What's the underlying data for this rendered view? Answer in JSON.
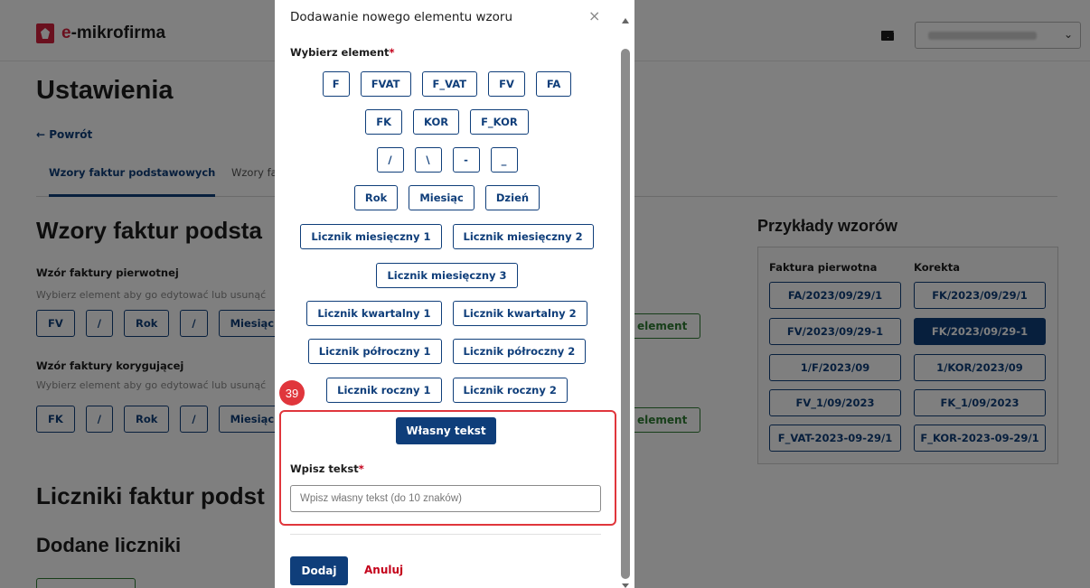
{
  "header": {
    "brand": "e-mikrofirma",
    "user_name": "",
    "mail_icon": "mail-icon",
    "chevron_icon": "chevron-down-icon"
  },
  "page": {
    "title": "Ustawienia",
    "back": "← Powrót",
    "tabs": [
      "Wzory faktur podstawowych",
      "Wzory fa"
    ],
    "section_title": "Wzory faktur podsta",
    "primary_label": "Wzór faktury pierwotnej",
    "primary_hint": "Wybierz element aby go edytować lub usunąć",
    "primary_chips": [
      "FV",
      "/",
      "Rok",
      "/",
      "Miesiąc"
    ],
    "correction_label": "Wzór faktury korygującej",
    "correction_hint": "Wybierz element aby go edytować lub usunąć",
    "correction_chips": [
      "FK",
      "/",
      "Rok",
      "/",
      "Miesiąc"
    ],
    "add_element": "element",
    "counters_title": "Liczniki faktur podst",
    "added_counters_title": "Dodane liczniki"
  },
  "examples": {
    "title": "Przykłady wzorów",
    "col_primary": "Faktura pierwotna",
    "col_correction": "Korekta",
    "rows": [
      [
        "FA/2023/09/29/1",
        "FK/2023/09/29/1"
      ],
      [
        "FV/2023/09/29-1",
        "FK/2023/09/29-1"
      ],
      [
        "1/F/2023/09",
        "1/KOR/2023/09"
      ],
      [
        "FV_1/09/2023",
        "FK_1/09/2023"
      ],
      [
        "F_VAT-2023-09-29/1",
        "F_KOR-2023-09-29/1"
      ]
    ],
    "selected": "FK/2023/09/29-1"
  },
  "modal": {
    "title": "Dodawanie nowego elementu wzoru",
    "close": "×",
    "choose_label": "Wybierz element",
    "required_mark": "*",
    "row1": [
      "F",
      "FVAT",
      "F_VAT",
      "FV",
      "FA"
    ],
    "row2": [
      "FK",
      "KOR",
      "F_KOR"
    ],
    "row3": [
      "/",
      "\\",
      "-",
      "_"
    ],
    "row4": [
      "Rok",
      "Miesiąc",
      "Dzień"
    ],
    "row5": [
      "Licznik miesięczny 1",
      "Licznik miesięczny 2"
    ],
    "row6": [
      "Licznik miesięczny 3"
    ],
    "row7": [
      "Licznik kwartalny 1",
      "Licznik kwartalny 2"
    ],
    "row8": [
      "Licznik półroczny 1",
      "Licznik półroczny 2"
    ],
    "row9": [
      "Licznik roczny 1",
      "Licznik roczny 2"
    ],
    "badge": "39",
    "own_text_button": "Własny tekst",
    "text_label": "Wpisz tekst",
    "text_placeholder": "Wpisz własny tekst (do 10 znaków)",
    "text_value": "",
    "add_button": "Dodaj",
    "cancel_button": "Anuluj"
  },
  "colors": {
    "primary": "#0f3e7a",
    "danger": "#c4001a",
    "highlight": "#e0363c",
    "success": "#2e7d32"
  }
}
